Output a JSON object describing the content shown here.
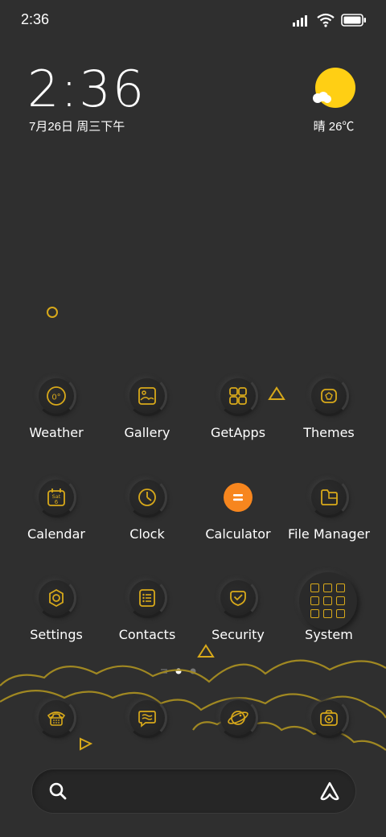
{
  "status_bar": {
    "time": "2:36"
  },
  "clock_widget": {
    "time": "2:36",
    "date": "7月26日 周三下午"
  },
  "weather_widget": {
    "text": "晴 26℃"
  },
  "apps": [
    {
      "label": "Weather"
    },
    {
      "label": "Gallery"
    },
    {
      "label": "GetApps"
    },
    {
      "label": "Themes"
    },
    {
      "label": "Calendar"
    },
    {
      "label": "Clock"
    },
    {
      "label": "Calculator"
    },
    {
      "label": "File Manager"
    },
    {
      "label": "Settings"
    },
    {
      "label": "Contacts"
    },
    {
      "label": "Security"
    },
    {
      "label": "System"
    }
  ],
  "calendar_icon": {
    "day": "Sat",
    "date": "6"
  },
  "weather_icon": {
    "temp": "0°"
  },
  "colors": {
    "accent": "#d8a91a",
    "sun": "#ffcf14",
    "calculator": "#f7861e",
    "background": "#2f2f2f"
  }
}
